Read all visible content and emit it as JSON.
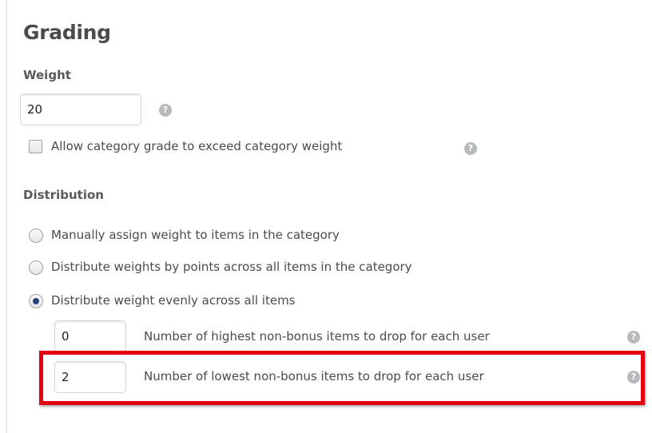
{
  "section": {
    "title": "Grading"
  },
  "weight": {
    "label": "Weight",
    "value": "20",
    "help_icon": "help-circle-icon"
  },
  "exceed": {
    "checked": false,
    "label": "Allow category grade to exceed category weight",
    "help_icon": "help-circle-icon"
  },
  "distribution": {
    "label": "Distribution",
    "options": [
      {
        "label": "Manually assign weight to items in the category",
        "selected": false
      },
      {
        "label": "Distribute weights by points across all items in the category",
        "selected": false
      },
      {
        "label": "Distribute weight evenly across all items",
        "selected": true
      }
    ],
    "drop_highest": {
      "value": "0",
      "label": "Number of highest non-bonus items to drop for each user"
    },
    "drop_lowest": {
      "value": "2",
      "label": "Number of lowest non-bonus items to drop for each user"
    }
  },
  "icons": {
    "help_glyph": "?"
  },
  "colors": {
    "highlight": "#e50012",
    "radio_selected": "#27437a",
    "text": "#494c4e"
  }
}
